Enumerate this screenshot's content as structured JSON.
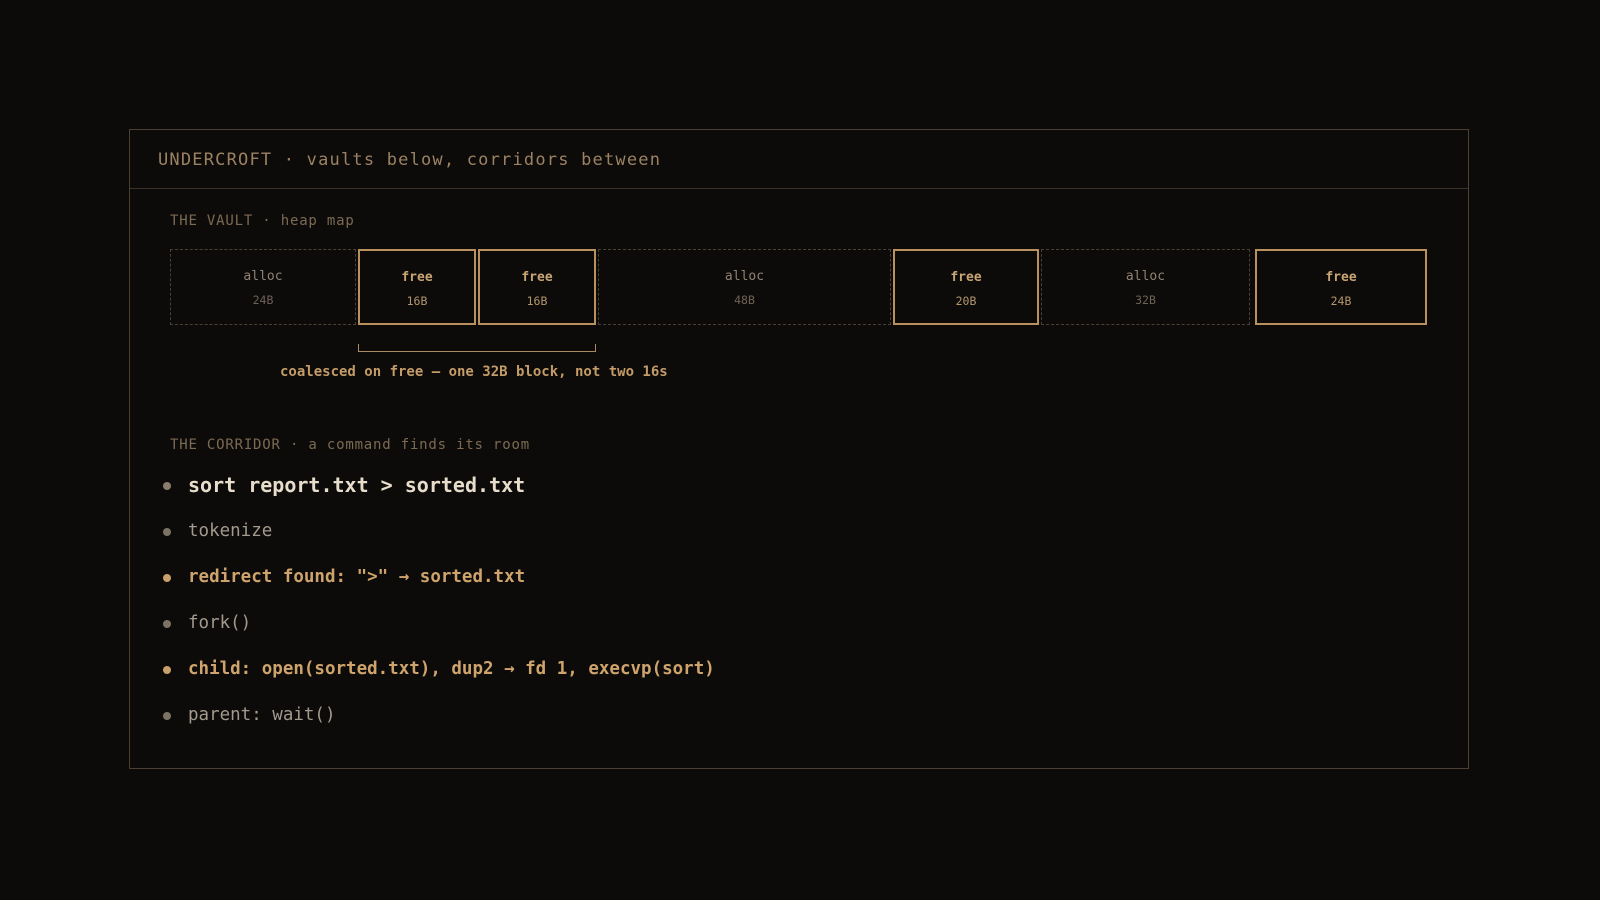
{
  "title": "UNDERCROFT · vaults below, corridors between",
  "vault": {
    "label": "THE VAULT · heap map",
    "blocks": [
      {
        "kind": "alloc",
        "size": "24B"
      },
      {
        "kind": "free",
        "size": "16B"
      },
      {
        "kind": "free",
        "size": "16B"
      },
      {
        "kind": "alloc",
        "size": "48B"
      },
      {
        "kind": "free",
        "size": "20B"
      },
      {
        "kind": "alloc",
        "size": "32B"
      },
      {
        "kind": "free",
        "size": "24B"
      }
    ],
    "coalesce_note": "coalesced on free — one 32B block, not two 16s"
  },
  "corridor": {
    "label": "THE CORRIDOR · a command finds its room",
    "steps": [
      {
        "text": "sort report.txt > sorted.txt",
        "style": "primary"
      },
      {
        "text": "tokenize",
        "style": "muted"
      },
      {
        "text": "redirect found: \">\" → sorted.txt",
        "style": "accent"
      },
      {
        "text": "fork()",
        "style": "muted"
      },
      {
        "text": "child: open(sorted.txt), dup2 → fd 1, execvp(sort)",
        "style": "accent"
      },
      {
        "text": "parent: wait()",
        "style": "muted"
      }
    ]
  },
  "colors": {
    "background": "#0c0b09",
    "accent": "#c9a06a",
    "frame": "#4d4032"
  }
}
